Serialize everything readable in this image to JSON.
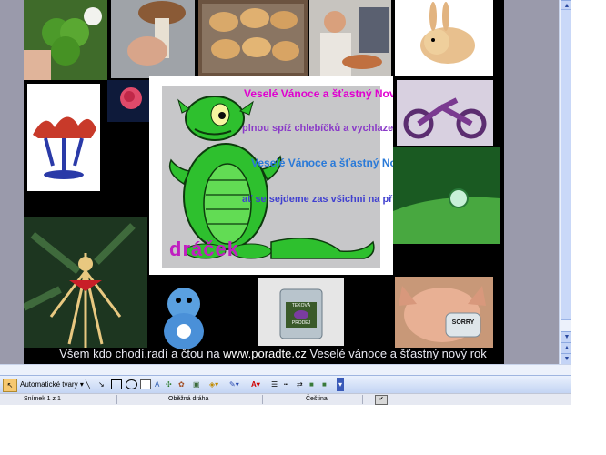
{
  "slide": {
    "card": {
      "lines": [
        "Veselé Vánoce a šťastný Nový rok,",
        "plnou spíž chlebíčků a vychlazený mok,",
        "Veselé Vánoce a šťastný Nový rok,",
        "ať se sejdeme zas všichni na přes rok!"
      ],
      "signature": "dráček"
    },
    "footer": {
      "before": "Všem kdo chodí,radí a čtou na ",
      "link": "www.poradte.cz",
      "after": " Veselé vánoce a šťastný nový rok"
    },
    "labels": {
      "mask": "SORRY",
      "card_top": "TEKOVÁ",
      "card_bottom": "PRODEJ"
    }
  },
  "toolbar": {
    "shapes_label": "Automatické tvary",
    "shapes_arrow": "▾"
  },
  "status": {
    "slide": "Snímek 1 z 1",
    "design": "Oběžná dráha",
    "language": "Čeština"
  },
  "colors": {
    "slide_bg": "#9a9aab",
    "card_bg": "#c7c7c9",
    "dragon": "#2ec02e"
  }
}
